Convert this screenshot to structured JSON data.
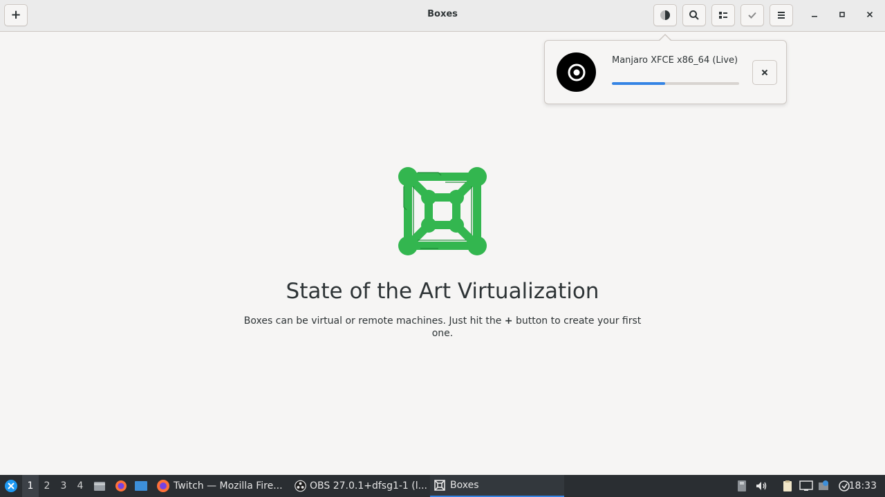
{
  "window": {
    "title": "Boxes",
    "buttons": {
      "new": "+",
      "theme_icon": "theme-toggle-icon",
      "search_icon": "search-icon",
      "view_icon": "view-mode-icon",
      "select_icon": "check-icon",
      "menu_icon": "hamburger-menu-icon"
    }
  },
  "download_popover": {
    "name": "Manjaro XFCE x86_64 (Live)",
    "progress": 0.42,
    "icon": "disc-icon",
    "cancel_icon": "close-icon"
  },
  "empty_state": {
    "title": "State of the Art Virtualization",
    "text_before": "Boxes can be virtual or remote machines. Just hit the",
    "text_plus": "+",
    "text_after": "button to create your first one."
  },
  "taskbar": {
    "workspaces": [
      "1",
      "2",
      "3",
      "4"
    ],
    "active_workspace": "1",
    "tasks": [
      {
        "label": "Twitch — Mozilla Fire...",
        "icon": "firefox-icon"
      },
      {
        "label": "OBS 27.0.1+dfsg1-1 (l...",
        "icon": "obs-icon"
      },
      {
        "label": "Boxes",
        "icon": "boxes-icon"
      }
    ],
    "clock": "18:33"
  },
  "colors": {
    "accent": "#3584e4",
    "logo_green": "#33b64f",
    "taskbar_bg": "#2a2e32"
  }
}
